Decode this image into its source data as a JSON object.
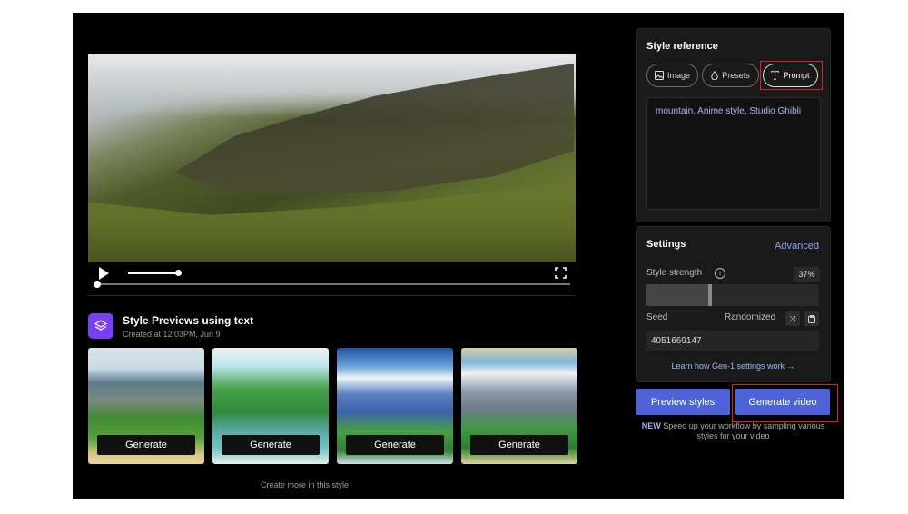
{
  "preview": {
    "title": "Style Previews using text",
    "subtitle": "Created at 12:03PM, Jun 9",
    "generate_labels": [
      "Generate",
      "Generate",
      "Generate",
      "Generate"
    ],
    "create_more": "Create more in this style"
  },
  "style_reference": {
    "title": "Style reference",
    "tabs": [
      {
        "label": "Image",
        "icon": "image-icon"
      },
      {
        "label": "Presets",
        "icon": "drop-icon"
      },
      {
        "label": "Prompt",
        "icon": "text-icon"
      }
    ],
    "selected_tab": "Prompt",
    "prompt_text": "mountain, Anime style, Studio Ghibli"
  },
  "settings": {
    "title": "Settings",
    "advanced_label": "Advanced",
    "style_strength_label": "Style strength",
    "style_strength_value": "37%",
    "style_strength_fraction": 0.37,
    "seed_label": "Seed",
    "randomized_label": "Randomized",
    "seed_value": "4051669147",
    "learn_link": "Learn how Gen-1 settings work →"
  },
  "actions": {
    "preview_label": "Preview styles",
    "generate_label": "Generate video",
    "note_new": "NEW",
    "note_text": " Speed up your workflow by sampling various styles for your video"
  },
  "colors": {
    "accent": "#4f63d8",
    "accent_text": "#a7b4f5",
    "highlight": "#e01d2a",
    "brand_purple": "#7b3ff2"
  }
}
